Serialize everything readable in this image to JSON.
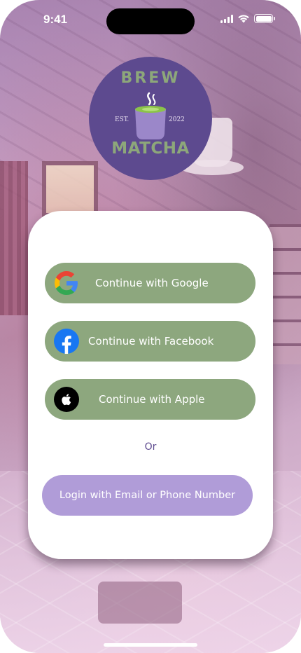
{
  "status_bar": {
    "time": "9:41"
  },
  "logo": {
    "top_text": "BREW",
    "bottom_text": "MATCHA",
    "est_label": "EST.",
    "year": "2022",
    "colors": {
      "circle": "#5d4a8f",
      "text": "#8da77a",
      "cup": "#9b87c9",
      "matcha": "#8bc34a"
    }
  },
  "auth": {
    "google_label": "Continue with Google",
    "facebook_label": "Continue with Facebook",
    "apple_label": "Continue with Apple",
    "divider_text": "Or",
    "email_label": "Login with Email or Phone Number"
  },
  "icons": {
    "google": "google-icon",
    "facebook": "facebook-icon",
    "apple": "apple-icon"
  },
  "colors": {
    "social_button": "#8da77e",
    "email_button": "#b09cd8",
    "accent_text": "#5d4a8f",
    "card": "#ffffff"
  }
}
